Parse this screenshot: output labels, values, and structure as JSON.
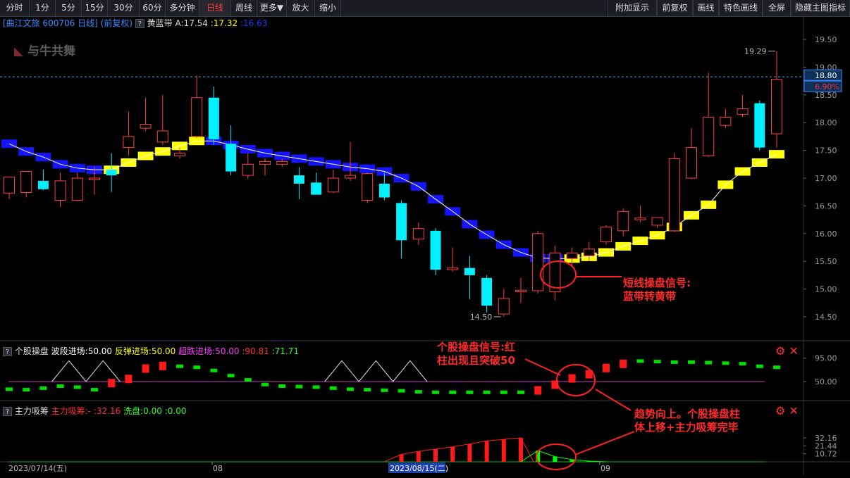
{
  "toolbar": {
    "left": [
      "分时",
      "1分",
      "5分",
      "15分",
      "30分",
      "60分",
      "多分钟",
      "日线",
      "周线",
      "更多▼",
      "放大",
      "缩小"
    ],
    "active": "日线",
    "right": [
      "附加显示",
      "前复权",
      "画线",
      "特色画线",
      "全屏",
      "隐藏主图指标"
    ]
  },
  "main_panel": {
    "stock_title": "[曲江文旅 600706 日线]",
    "adjust": "(前复权)",
    "indicator_name": "黄蓝带",
    "indicator_a": "A:17.54",
    "indicator_b": ":17.32",
    "indicator_c": ":16.63",
    "watermark": "与牛共舞",
    "high_label": "19.29",
    "low_label": "14.50",
    "price_badge": "18.80",
    "pct_badge": "6.90%",
    "y_ticks": [
      "19.50",
      "19.00",
      "18.50",
      "18.00",
      "17.50",
      "17.00",
      "16.50",
      "16.00",
      "15.50",
      "15.00",
      "14.50"
    ]
  },
  "panel2": {
    "name": "个股操盘",
    "label1": "波段进场:50.00",
    "label2": "反弹进场:50.00",
    "label3": "超跌进场:50.00",
    "label4": ":90.81",
    "label5": ":71.71",
    "y_ticks": [
      "95.00",
      "50.00"
    ]
  },
  "panel3": {
    "name": "主力吸筹",
    "label1": "主力吸筹:-",
    "label2": ":32.16",
    "label3": "洗盘:0.00",
    "label4": ":0.00",
    "y_ticks": [
      "32.16",
      "21.44",
      "10.72"
    ]
  },
  "x_axis": {
    "start": "2023/07/14(五)",
    "m1": "08",
    "cursor": "2023/08/15(二)",
    "m2": "09"
  },
  "annotations": {
    "a1_line1": "短线操盘信号:",
    "a1_line2": "蓝带转黄带",
    "a2_line1": "个股操盘信号:红",
    "a2_line2": "柱出现且突破50",
    "a3_line1": "趋势向上。个股操盘柱",
    "a3_line2": "体上移+主力吸筹完毕"
  },
  "chart_data": {
    "type": "candlestick",
    "candles": [
      {
        "o": 16.73,
        "h": 17.02,
        "l": 16.62,
        "c": 17.02
      },
      {
        "o": 16.74,
        "h": 17.1,
        "l": 16.65,
        "c": 17.12
      },
      {
        "o": 16.95,
        "h": 17.15,
        "l": 16.78,
        "c": 16.8
      },
      {
        "o": 16.6,
        "h": 17.1,
        "l": 16.48,
        "c": 16.95
      },
      {
        "o": 16.6,
        "h": 17.1,
        "l": 16.58,
        "c": 17.0
      },
      {
        "o": 16.97,
        "h": 17.2,
        "l": 16.7,
        "c": 17.0
      },
      {
        "o": 17.15,
        "h": 17.45,
        "l": 16.75,
        "c": 17.05
      },
      {
        "o": 17.55,
        "h": 18.2,
        "l": 17.4,
        "c": 17.75
      },
      {
        "o": 17.9,
        "h": 18.45,
        "l": 17.85,
        "c": 17.97
      },
      {
        "o": 17.65,
        "h": 18.5,
        "l": 17.6,
        "c": 17.85
      },
      {
        "o": 17.4,
        "h": 17.55,
        "l": 17.35,
        "c": 17.45
      },
      {
        "o": 17.75,
        "h": 18.85,
        "l": 17.72,
        "c": 18.45
      },
      {
        "o": 18.45,
        "h": 18.65,
        "l": 17.6,
        "c": 17.7
      },
      {
        "o": 17.62,
        "h": 17.95,
        "l": 17.05,
        "c": 17.12
      },
      {
        "o": 17.05,
        "h": 17.45,
        "l": 16.98,
        "c": 17.25
      },
      {
        "o": 17.25,
        "h": 17.35,
        "l": 17.05,
        "c": 17.3
      },
      {
        "o": 17.25,
        "h": 17.35,
        "l": 17.2,
        "c": 17.3
      },
      {
        "o": 17.05,
        "h": 17.2,
        "l": 16.62,
        "c": 16.9
      },
      {
        "o": 16.92,
        "h": 17.1,
        "l": 16.8,
        "c": 16.7
      },
      {
        "o": 16.75,
        "h": 17.15,
        "l": 16.73,
        "c": 17.0
      },
      {
        "o": 17.0,
        "h": 17.65,
        "l": 16.95,
        "c": 17.05
      },
      {
        "o": 16.6,
        "h": 17.1,
        "l": 16.55,
        "c": 17.08
      },
      {
        "o": 16.9,
        "h": 17.1,
        "l": 16.6,
        "c": 16.65
      },
      {
        "o": 16.55,
        "h": 16.6,
        "l": 15.55,
        "c": 15.88
      },
      {
        "o": 15.9,
        "h": 16.2,
        "l": 15.8,
        "c": 16.09
      },
      {
        "o": 16.05,
        "h": 16.1,
        "l": 15.25,
        "c": 15.35
      },
      {
        "o": 15.35,
        "h": 15.75,
        "l": 15.32,
        "c": 15.38
      },
      {
        "o": 15.38,
        "h": 15.6,
        "l": 14.82,
        "c": 15.25
      },
      {
        "o": 15.2,
        "h": 15.25,
        "l": 14.58,
        "c": 14.7
      },
      {
        "o": 14.55,
        "h": 15.0,
        "l": 14.5,
        "c": 14.83
      },
      {
        "o": 14.95,
        "h": 15.2,
        "l": 14.75,
        "c": 14.98
      },
      {
        "o": 14.97,
        "h": 16.05,
        "l": 14.92,
        "c": 16.0
      },
      {
        "o": 14.95,
        "h": 15.78,
        "l": 14.8,
        "c": 15.65
      },
      {
        "o": 15.55,
        "h": 15.75,
        "l": 15.4,
        "c": 15.65
      },
      {
        "o": 15.6,
        "h": 15.85,
        "l": 15.5,
        "c": 15.72
      },
      {
        "o": 15.85,
        "h": 16.15,
        "l": 15.8,
        "c": 16.12
      },
      {
        "o": 16.05,
        "h": 16.45,
        "l": 15.95,
        "c": 16.4
      },
      {
        "o": 16.25,
        "h": 16.5,
        "l": 16.2,
        "c": 16.28
      },
      {
        "o": 16.15,
        "h": 16.3,
        "l": 16.1,
        "c": 16.29
      },
      {
        "o": 16.05,
        "h": 17.45,
        "l": 16.03,
        "c": 17.35
      },
      {
        "o": 17.0,
        "h": 17.9,
        "l": 16.98,
        "c": 17.55
      },
      {
        "o": 17.4,
        "h": 18.9,
        "l": 17.38,
        "c": 18.1
      },
      {
        "o": 17.95,
        "h": 18.25,
        "l": 17.9,
        "c": 18.1
      },
      {
        "o": 18.15,
        "h": 18.5,
        "l": 18.1,
        "c": 18.25
      },
      {
        "o": 18.35,
        "h": 18.4,
        "l": 17.5,
        "c": 17.55
      },
      {
        "o": 17.8,
        "h": 19.29,
        "l": 17.55,
        "c": 18.78
      }
    ],
    "band": [
      {
        "y": 17.62,
        "c": "b"
      },
      {
        "y": 17.48,
        "c": "b"
      },
      {
        "y": 17.38,
        "c": "b"
      },
      {
        "y": 17.25,
        "c": "b"
      },
      {
        "y": 17.18,
        "c": "b"
      },
      {
        "y": 17.15,
        "c": "b"
      },
      {
        "y": 17.15,
        "c": "y"
      },
      {
        "y": 17.28,
        "c": "y"
      },
      {
        "y": 17.4,
        "c": "y"
      },
      {
        "y": 17.48,
        "c": "y"
      },
      {
        "y": 17.58,
        "c": "y"
      },
      {
        "y": 17.67,
        "c": "y"
      },
      {
        "y": 17.67,
        "c": "b"
      },
      {
        "y": 17.6,
        "c": "b"
      },
      {
        "y": 17.52,
        "c": "b"
      },
      {
        "y": 17.45,
        "c": "b"
      },
      {
        "y": 17.4,
        "c": "b"
      },
      {
        "y": 17.35,
        "c": "b"
      },
      {
        "y": 17.3,
        "c": "b"
      },
      {
        "y": 17.25,
        "c": "b"
      },
      {
        "y": 17.2,
        "c": "b"
      },
      {
        "y": 17.17,
        "c": "b"
      },
      {
        "y": 17.12,
        "c": "b"
      },
      {
        "y": 17.0,
        "c": "b"
      },
      {
        "y": 16.85,
        "c": "b"
      },
      {
        "y": 16.62,
        "c": "b"
      },
      {
        "y": 16.4,
        "c": "b"
      },
      {
        "y": 16.17,
        "c": "b"
      },
      {
        "y": 15.98,
        "c": "b"
      },
      {
        "y": 15.8,
        "c": "b"
      },
      {
        "y": 15.66,
        "c": "b"
      },
      {
        "y": 15.56,
        "c": "b"
      },
      {
        "y": 15.55,
        "c": "b"
      },
      {
        "y": 15.55,
        "c": "y"
      },
      {
        "y": 15.58,
        "c": "y"
      },
      {
        "y": 15.66,
        "c": "y"
      },
      {
        "y": 15.77,
        "c": "y"
      },
      {
        "y": 15.87,
        "c": "y"
      },
      {
        "y": 15.97,
        "c": "y"
      },
      {
        "y": 16.12,
        "c": "y"
      },
      {
        "y": 16.33,
        "c": "y"
      },
      {
        "y": 16.52,
        "c": "y"
      },
      {
        "y": 16.88,
        "c": "y"
      },
      {
        "y": 17.12,
        "c": "y"
      },
      {
        "y": 17.28,
        "c": "y"
      },
      {
        "y": 17.43,
        "c": "y"
      }
    ],
    "osc": [
      {
        "v": 36,
        "c": "g"
      },
      {
        "v": 35,
        "c": "g"
      },
      {
        "v": 38,
        "c": "g"
      },
      {
        "v": 42,
        "c": "g"
      },
      {
        "v": 40,
        "c": "g"
      },
      {
        "v": 35,
        "c": "g"
      },
      {
        "v": 47,
        "c": "r"
      },
      {
        "v": 55,
        "c": "r"
      },
      {
        "v": 75,
        "c": "r"
      },
      {
        "v": 80,
        "c": "r"
      },
      {
        "v": 80,
        "c": "g"
      },
      {
        "v": 78,
        "c": "g"
      },
      {
        "v": 72,
        "c": "g"
      },
      {
        "v": 62,
        "c": "g"
      },
      {
        "v": 54,
        "c": "g"
      },
      {
        "v": 45,
        "c": "g"
      },
      {
        "v": 42,
        "c": "g"
      },
      {
        "v": 41,
        "c": "g"
      },
      {
        "v": 40,
        "c": "g"
      },
      {
        "v": 38,
        "c": "g"
      },
      {
        "v": 36,
        "c": "g"
      },
      {
        "v": 35,
        "c": "g"
      },
      {
        "v": 34,
        "c": "g"
      },
      {
        "v": 33,
        "c": "g"
      },
      {
        "v": 31,
        "c": "g"
      },
      {
        "v": 30,
        "c": "g"
      },
      {
        "v": 30,
        "c": "g"
      },
      {
        "v": 30,
        "c": "g"
      },
      {
        "v": 30,
        "c": "g"
      },
      {
        "v": 30,
        "c": "g"
      },
      {
        "v": 30,
        "c": "g"
      },
      {
        "v": 33,
        "c": "r"
      },
      {
        "v": 44,
        "c": "r"
      },
      {
        "v": 56,
        "c": "r"
      },
      {
        "v": 64,
        "c": "r"
      },
      {
        "v": 76,
        "c": "r"
      },
      {
        "v": 84,
        "c": "r"
      },
      {
        "v": 90,
        "c": "g"
      },
      {
        "v": 89,
        "c": "g"
      },
      {
        "v": 88,
        "c": "g"
      },
      {
        "v": 88,
        "c": "g"
      },
      {
        "v": 87,
        "c": "g"
      },
      {
        "v": 86,
        "c": "g"
      },
      {
        "v": 85,
        "c": "g"
      },
      {
        "v": 80,
        "c": "g"
      },
      {
        "v": 78,
        "c": "g"
      }
    ],
    "osc_tri": [
      [
        3,
        5
      ],
      [
        5,
        7
      ],
      [
        19,
        21
      ],
      [
        21,
        23
      ],
      [
        23,
        25
      ]
    ],
    "accum": [
      {
        "i": 23,
        "v": 10,
        "c": "r"
      },
      {
        "i": 24,
        "v": 14,
        "c": "r"
      },
      {
        "i": 25,
        "v": 17,
        "c": "r"
      },
      {
        "i": 26,
        "v": 20,
        "c": "r"
      },
      {
        "i": 27,
        "v": 24,
        "c": "r"
      },
      {
        "i": 28,
        "v": 28,
        "c": "r"
      },
      {
        "i": 29,
        "v": 30,
        "c": "r"
      },
      {
        "i": 30,
        "v": 32.16,
        "c": "r"
      },
      {
        "i": 31,
        "v": 15,
        "c": "g"
      },
      {
        "i": 32,
        "v": 7,
        "c": "g"
      },
      {
        "i": 33,
        "v": 3,
        "c": "g"
      },
      {
        "i": 34,
        "v": 1,
        "c": "g"
      }
    ]
  }
}
